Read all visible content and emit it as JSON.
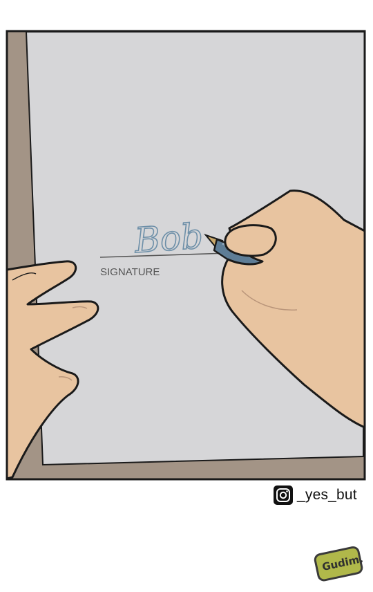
{
  "panel": {
    "signature_name": "Bob",
    "signature_label": "SIGNATURE"
  },
  "credit": {
    "icon": "instagram-icon",
    "handle": "_yes_but"
  },
  "watermark": {
    "text": "Gudim."
  },
  "colors": {
    "frame": "#1a1a1a",
    "desk": "#a39486",
    "paper": "#d6d6d8",
    "skin": "#e8c4a0",
    "pen_body": "#5e7d96",
    "ink": "#6d8fa8",
    "logo_bg": "#b0b84a"
  }
}
